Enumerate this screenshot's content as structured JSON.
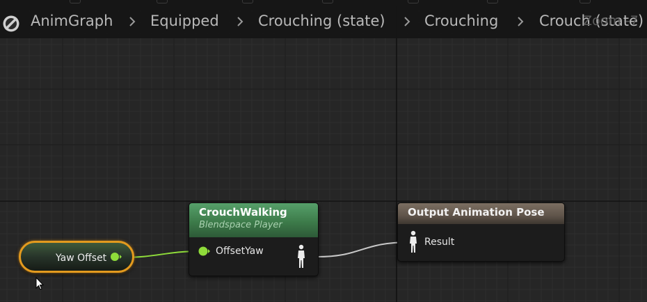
{
  "breadcrumb": {
    "items": [
      {
        "label": "AnimGraph"
      },
      {
        "label": "Equipped"
      },
      {
        "label": "Crouching (state)"
      },
      {
        "label": "Crouching"
      },
      {
        "label": "Crouch (state)"
      }
    ],
    "zoom": "Zoom -7"
  },
  "nodes": {
    "crouchwalking": {
      "title": "CrouchWalking",
      "subtitle": "Blendspace Player",
      "input_pin": "OffsetYaw",
      "header_color": "#3d7b4a"
    },
    "output": {
      "title": "Output Animation Pose",
      "input_pin": "Result",
      "header_color": "#5f544a"
    },
    "yaw_offset": {
      "label": "Yaw Offset",
      "outline_color": "#e39a1e",
      "pin_color": "#8fdc3a"
    }
  },
  "colors": {
    "background": "#262626",
    "float_pin": "#8fdc3a",
    "exec_wire": "#c8c8c8"
  },
  "icons": [
    "graph-badge-icon",
    "chevron-right-icon",
    "pose-pin-icon",
    "float-pin-icon",
    "mouse-cursor-icon"
  ]
}
